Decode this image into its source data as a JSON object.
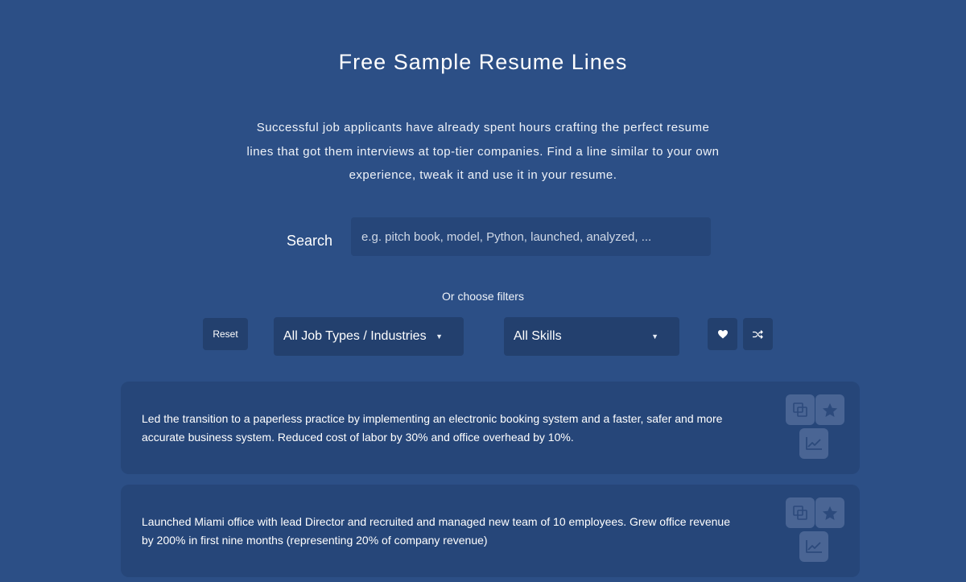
{
  "page": {
    "title": "Free Sample Resume Lines",
    "intro": "Successful job applicants have already spent hours crafting the perfect resume lines that got them interviews at top-tier companies. Find a line similar to your own experience, tweak it and use it in your resume."
  },
  "search": {
    "label": "Search",
    "placeholder": "e.g. pitch book, model, Python, launched, analyzed, ...",
    "value": ""
  },
  "filters": {
    "heading": "Or choose filters",
    "reset_label": "Reset",
    "job_types": {
      "selected": "All Job Types / Industries"
    },
    "skills": {
      "selected": "All Skills"
    },
    "favorites_icon": "heart-icon",
    "shuffle_icon": "shuffle-icon"
  },
  "results": [
    {
      "text": "Led the transition to a paperless practice by implementing an electronic booking system and a faster, safer and more accurate business system. Reduced cost of labor by 30% and office overhead by 10%.",
      "actions": [
        "copy-icon",
        "star-icon",
        "chart-icon"
      ]
    },
    {
      "text": "Launched Miami office with lead Director and recruited and managed new team of 10 employees. Grew office revenue by 200% in first nine months (representing 20% of company revenue)",
      "actions": [
        "copy-icon",
        "star-icon",
        "chart-icon"
      ]
    }
  ],
  "colors": {
    "background": "#2c4f86",
    "panel": "#264679",
    "button": "#23406e",
    "icon_button": "#4a6594",
    "icon_glyph": "#2c4a7c"
  }
}
